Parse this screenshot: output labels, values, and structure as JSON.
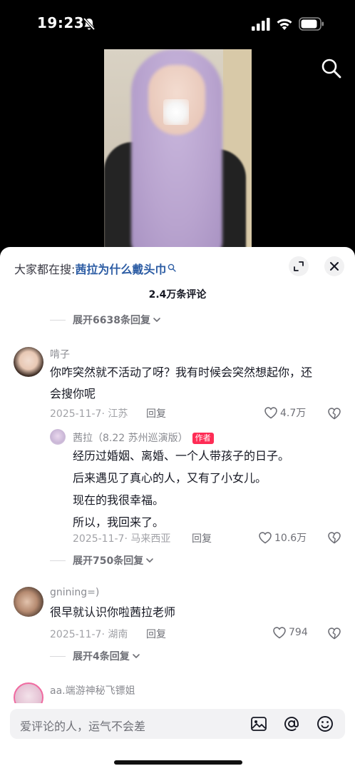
{
  "status_bar": {
    "time": "19:23"
  },
  "search_hint": {
    "prefix": "大家都在搜:",
    "term": "茜拉为什么戴头巾"
  },
  "comment_count": "2.4万条评论",
  "expand_top": {
    "label": "展开6638条回复"
  },
  "comments": [
    {
      "username": "啃子",
      "text_line1": "你咋突然就不活动了呀？我有时候会突然想起你，还",
      "text_line2": "会搜你呢",
      "date_location": "2025-11-7· 江苏",
      "reply_label": "回复",
      "likes": "4.7万"
    },
    {
      "username": "gnining=)",
      "text": "很早就认识你啦茜拉老师",
      "date_location": "2025-11-7· 湖南",
      "reply_label": "回复",
      "likes": "794"
    },
    {
      "username": "aa.端游神秘飞镖姐"
    }
  ],
  "author_reply": {
    "username": "茜拉（8.22 苏州巡演版）",
    "badge": "作者",
    "line1": "经历过婚姻、离婚、一个人带孩子的日子。",
    "line2": "后来遇见了真心的人，又有了小女儿。",
    "line3": "现在的我很幸福。",
    "line4": "所以，我回来了。",
    "date_location": "2025-11-7· 马来西亚",
    "reply_label": "回复",
    "likes": "10.6万"
  },
  "expand_mid": {
    "label": "展开750条回复"
  },
  "expand_bottom": {
    "label": "展开4条回复"
  },
  "input": {
    "placeholder": "爱评论的人，运气不会差"
  },
  "colors": {
    "accent": "#fe2c55",
    "link": "#2d5da4",
    "text": "#161823",
    "muted": "#a1a2a7"
  },
  "icons": [
    "bell-muted-icon",
    "signal-icon",
    "wifi-icon",
    "battery-icon",
    "search-icon",
    "expand-icon",
    "close-icon",
    "chevron-down-icon",
    "heart-icon",
    "broken-heart-icon",
    "image-icon",
    "at-icon",
    "emoji-icon"
  ]
}
